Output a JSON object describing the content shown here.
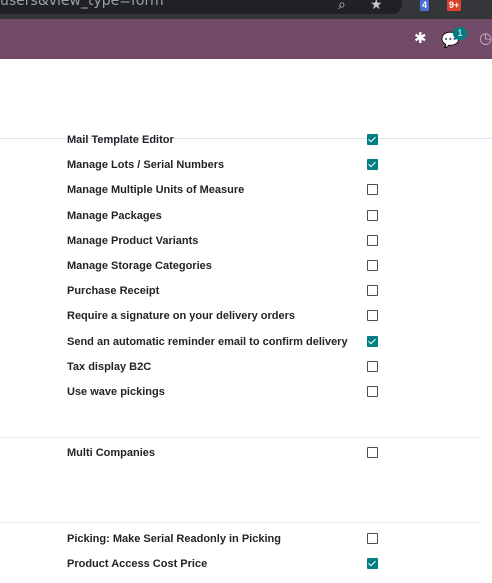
{
  "browser": {
    "url_fragment": "users&view_type=form",
    "ext_badge_1": "4",
    "ext_badge_2": "9+"
  },
  "navbar": {
    "chat_count": "1"
  },
  "groups": {
    "group_a": [
      {
        "label": "Mail Template Editor",
        "checked": true
      },
      {
        "label": "Manage Lots / Serial Numbers",
        "checked": true
      },
      {
        "label": "Manage Multiple Units of Measure",
        "checked": false
      },
      {
        "label": "Manage Packages",
        "checked": false
      },
      {
        "label": "Manage Product Variants",
        "checked": false
      },
      {
        "label": "Manage Storage Categories",
        "checked": false
      },
      {
        "label": "Purchase Receipt",
        "checked": false
      },
      {
        "label": "Require a signature on your delivery orders",
        "checked": false
      },
      {
        "label": "Send an automatic reminder email to confirm delivery",
        "checked": true
      },
      {
        "label": "Tax display B2C",
        "checked": false
      },
      {
        "label": "Use wave pickings",
        "checked": false
      }
    ],
    "group_b": [
      {
        "label": "Multi Companies",
        "checked": false
      }
    ],
    "group_c": [
      {
        "label": "Picking: Make Serial Readonly in Picking",
        "checked": false
      },
      {
        "label": "Product Access Cost Price",
        "checked": true
      }
    ]
  },
  "colors": {
    "navbar": "#714b67",
    "checkbox_checked": "#017e84"
  }
}
